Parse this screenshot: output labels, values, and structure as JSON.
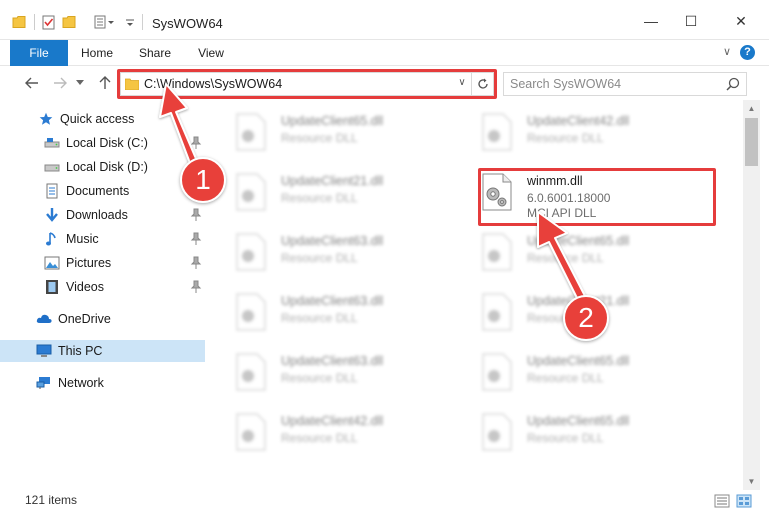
{
  "window": {
    "title": "SysWOW64",
    "minimize_glyph": "—",
    "maximize_glyph": "☐",
    "close_glyph": "✕"
  },
  "ribbon": {
    "tabs": [
      {
        "label": "File"
      },
      {
        "label": "Home"
      },
      {
        "label": "Share"
      },
      {
        "label": "View"
      }
    ],
    "help_glyph": "?"
  },
  "navigation": {
    "address_path": "C:\\Windows\\SysWOW64",
    "search_placeholder": "Search SysWOW64"
  },
  "sidebar": {
    "items": [
      {
        "label": "Quick access",
        "icon": "star-icon",
        "pinned": false
      },
      {
        "label": "Local Disk (C:)",
        "icon": "drive-icon",
        "pinned": true
      },
      {
        "label": "Local Disk (D:)",
        "icon": "drive-icon",
        "pinned": false
      },
      {
        "label": "Documents",
        "icon": "documents-icon",
        "pinned": true
      },
      {
        "label": "Downloads",
        "icon": "download-icon",
        "pinned": true
      },
      {
        "label": "Music",
        "icon": "music-icon",
        "pinned": true
      },
      {
        "label": "Pictures",
        "icon": "pictures-icon",
        "pinned": true
      },
      {
        "label": "Videos",
        "icon": "videos-icon",
        "pinned": true
      },
      {
        "label": "OneDrive",
        "icon": "cloud-icon",
        "pinned": false
      },
      {
        "label": "This PC",
        "icon": "computer-icon",
        "pinned": false,
        "selected": true
      },
      {
        "label": "Network",
        "icon": "network-icon",
        "pinned": false
      }
    ]
  },
  "files": [
    {
      "name": "UpdateClient65.dll",
      "desc": "Resource DLL"
    },
    {
      "name": "UpdateClient42.dll",
      "desc": "Resource DLL"
    },
    {
      "name": "UpdateClient21.dll",
      "desc": "Resource DLL"
    },
    {
      "name": "winmm.dll",
      "desc": "6.0.6001.18000",
      "desc2": "MCI API DLL",
      "highlighted": true
    },
    {
      "name": "UpdateClient63.dll",
      "desc": "Resource DLL"
    },
    {
      "name": "UpdateClient65.dll",
      "desc": "Resource DLL"
    },
    {
      "name": "UpdateClient63.dll",
      "desc": "Resource DLL"
    },
    {
      "name": "UpdateClient21.dll",
      "desc": "Resource DLL"
    },
    {
      "name": "UpdateClient63.dll",
      "desc": "Resource DLL"
    },
    {
      "name": "UpdateClient65.dll",
      "desc": "Resource DLL"
    },
    {
      "name": "UpdateClient42.dll",
      "desc": "Resource DLL"
    },
    {
      "name": "UpdateClient65.dll",
      "desc": "Resource DLL"
    }
  ],
  "status": {
    "item_count": "121 items"
  },
  "annotations": {
    "step1": "1",
    "step2": "2",
    "highlight_color": "#e53c3c"
  },
  "colors": {
    "accent": "#1979ca",
    "selected_bg": "#cce4f7",
    "badge": "#e8403a"
  }
}
